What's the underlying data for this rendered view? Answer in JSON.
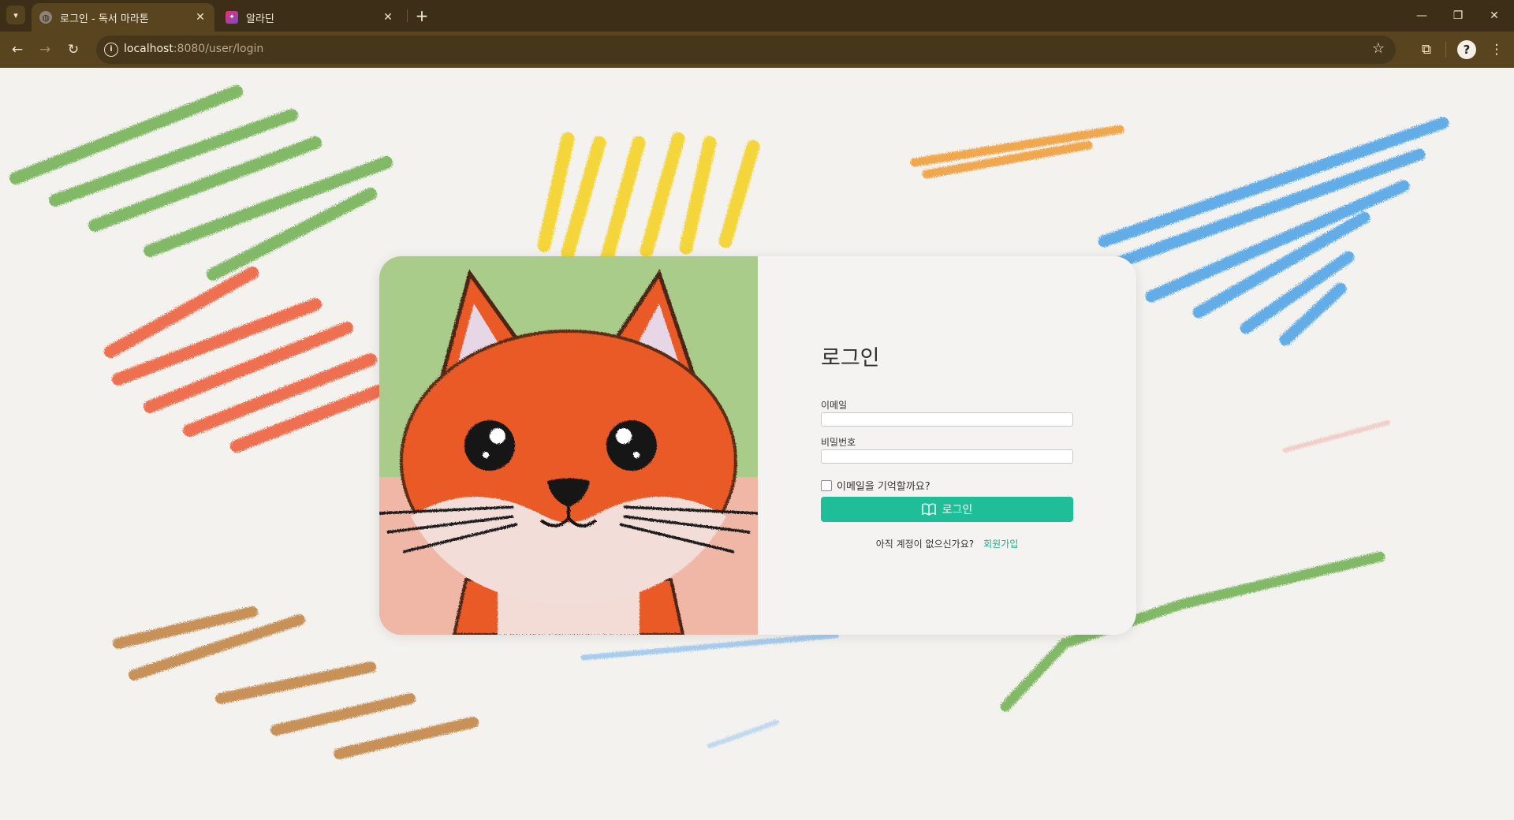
{
  "browser": {
    "tabs": [
      {
        "title": "로그인 - 독서 마라톤",
        "active": true
      },
      {
        "title": "알라딘",
        "active": false
      }
    ],
    "url_host": "localhost",
    "url_rest": ":8080/user/login",
    "accent": "#58451f"
  },
  "login": {
    "title": "로그인",
    "email_label": "이메일",
    "email_value": "",
    "password_label": "비밀번호",
    "password_value": "",
    "remember_label": "이메일을 기억할까요?",
    "remember_checked": false,
    "submit_label": "로그인",
    "signup_prompt": "아직 계정이 없으신가요?",
    "signup_link": "회원가입",
    "button_color": "#1fbd98"
  }
}
